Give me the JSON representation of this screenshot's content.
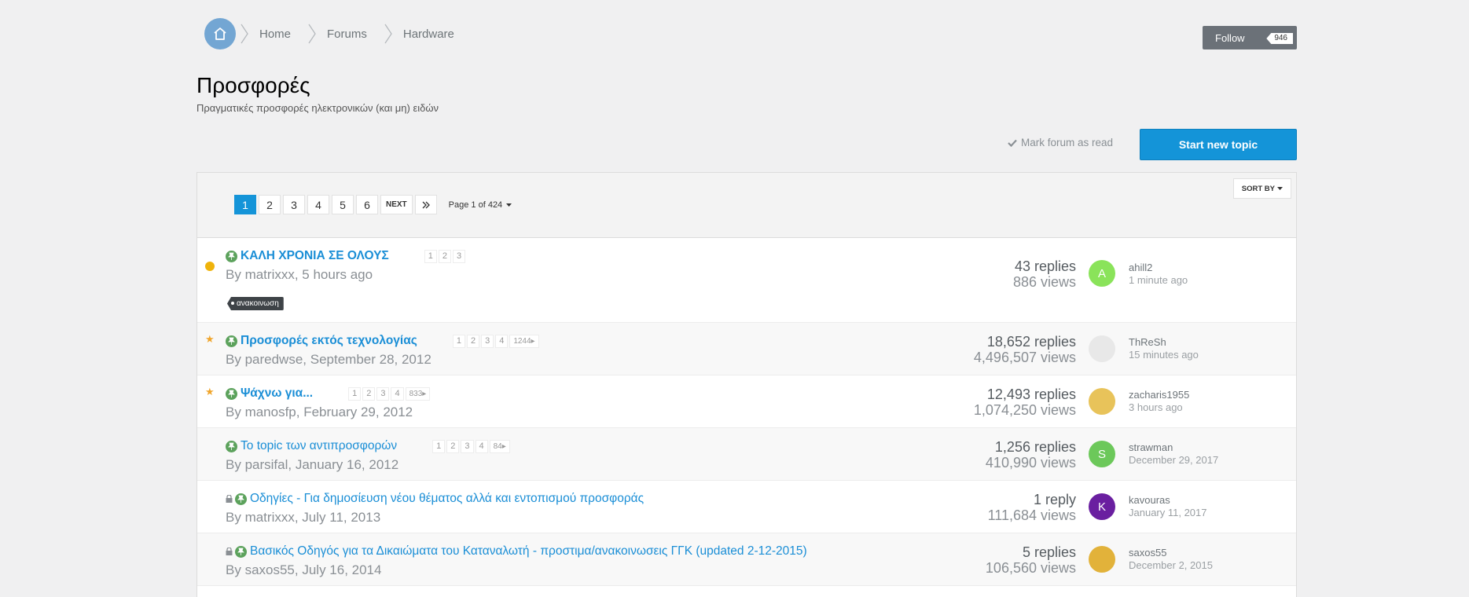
{
  "breadcrumb": [
    {
      "label": "Home"
    },
    {
      "label": "Forums"
    },
    {
      "label": "Hardware"
    }
  ],
  "follow": {
    "label": "Follow",
    "count": "946"
  },
  "forum": {
    "title": "Προσφορές",
    "subtitle": "Πραγματικές προσφορές ηλεκτρονικών (και μη) ειδών"
  },
  "actions": {
    "mark_read": "Mark forum as read",
    "start_topic": "Start new topic"
  },
  "pagination": {
    "pages": [
      "1",
      "2",
      "3",
      "4",
      "5",
      "6"
    ],
    "active": "1",
    "next": "NEXT",
    "page_of": "Page 1 of 424"
  },
  "sort": {
    "label": "SORT BY"
  },
  "colors": {
    "accent": "#1494d8",
    "pin": "#5ca25c",
    "unread": "#efb30b",
    "star": "#f0a52b"
  },
  "topics": [
    {
      "marker": "unread-dot",
      "pinned": true,
      "locked": false,
      "title": "ΚΑΛΗ ΧΡΟΝΙΑ ΣΕ ΟΛΟΥΣ",
      "minipages": [
        "1",
        "2",
        "3"
      ],
      "author": "matrixxx",
      "date": "5 hours ago",
      "tag": "ανακοινωση",
      "replies": "43 replies",
      "views": "886 views",
      "last_user": "ahill2",
      "last_time": "1 minute ago",
      "avatar_letter": "A",
      "avatar_color": "#8ae35a"
    },
    {
      "marker": "star",
      "pinned": true,
      "locked": false,
      "title": "Προσφορές εκτός τεχνολογίας",
      "minipages": [
        "1",
        "2",
        "3",
        "4"
      ],
      "last_page": "1244",
      "author": "paredwse",
      "date": "September 28, 2012",
      "replies": "18,652 replies",
      "views": "4,496,507 views",
      "last_user": "ThReSh",
      "last_time": "15 minutes ago",
      "avatar_letter": "",
      "avatar_color": "#e8e8e8"
    },
    {
      "marker": "star",
      "pinned": true,
      "locked": false,
      "title": "Ψάχνω για...",
      "minipages": [
        "1",
        "2",
        "3",
        "4"
      ],
      "last_page": "833",
      "author": "manosfp",
      "date": "February 29, 2012",
      "replies": "12,493 replies",
      "views": "1,074,250 views",
      "last_user": "zacharis1955",
      "last_time": "3 hours ago",
      "avatar_letter": "",
      "avatar_color": "#e8c35a"
    },
    {
      "marker": "",
      "pinned": true,
      "locked": false,
      "title": "Το topic των αντιπροσφορών",
      "minipages": [
        "1",
        "2",
        "3",
        "4"
      ],
      "last_page": "84",
      "author": "parsifal",
      "date": "January 16, 2012",
      "replies": "1,256 replies",
      "views": "410,990 views",
      "last_user": "strawman",
      "last_time": "December 29, 2017",
      "avatar_letter": "S",
      "avatar_color": "#6cc85a"
    },
    {
      "marker": "",
      "pinned": true,
      "locked": true,
      "title": "Οδηγίες - Για δημοσίευση νέου θέματος αλλά και εντοπισμού προσφοράς",
      "minipages": [],
      "author": "matrixxx",
      "date": "July 11, 2013",
      "replies": "1 reply",
      "views": "111,684 views",
      "last_user": "kavouras",
      "last_time": "January 11, 2017",
      "avatar_letter": "K",
      "avatar_color": "#6a1fa0"
    },
    {
      "marker": "",
      "pinned": true,
      "locked": true,
      "title": "Βασικός Οδηγός για τα Δικαιώματα του Καταναλωτή - προστιμα/ανακοινωσεις ΓΓΚ (updated 2-12-2015)",
      "minipages": [],
      "author": "saxos55",
      "date": "July 16, 2014",
      "replies": "5 replies",
      "views": "106,560 views",
      "last_user": "saxos55",
      "last_time": "December 2, 2015",
      "avatar_letter": "",
      "avatar_color": "#e2b23a"
    }
  ]
}
